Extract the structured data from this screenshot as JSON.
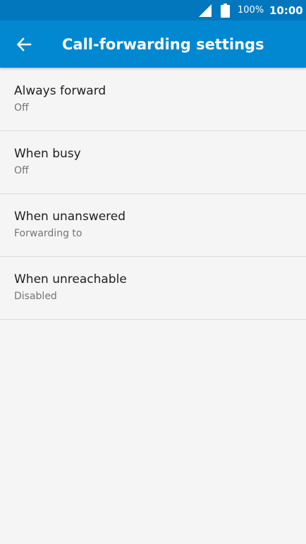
{
  "status_bar": {
    "battery_percent": "100%",
    "time": "10:00",
    "icons": [
      "signal-icon",
      "battery-icon"
    ]
  },
  "app_bar": {
    "title": "Call-forwarding settings",
    "back_icon": "arrow-left-icon",
    "color": "#0288d1"
  },
  "items": [
    {
      "label": "Always forward",
      "summary": "Off"
    },
    {
      "label": "When busy",
      "summary": "Off"
    },
    {
      "label": "When unanswered",
      "summary": "Forwarding to"
    },
    {
      "label": "When unreachable",
      "summary": "Disabled"
    }
  ]
}
